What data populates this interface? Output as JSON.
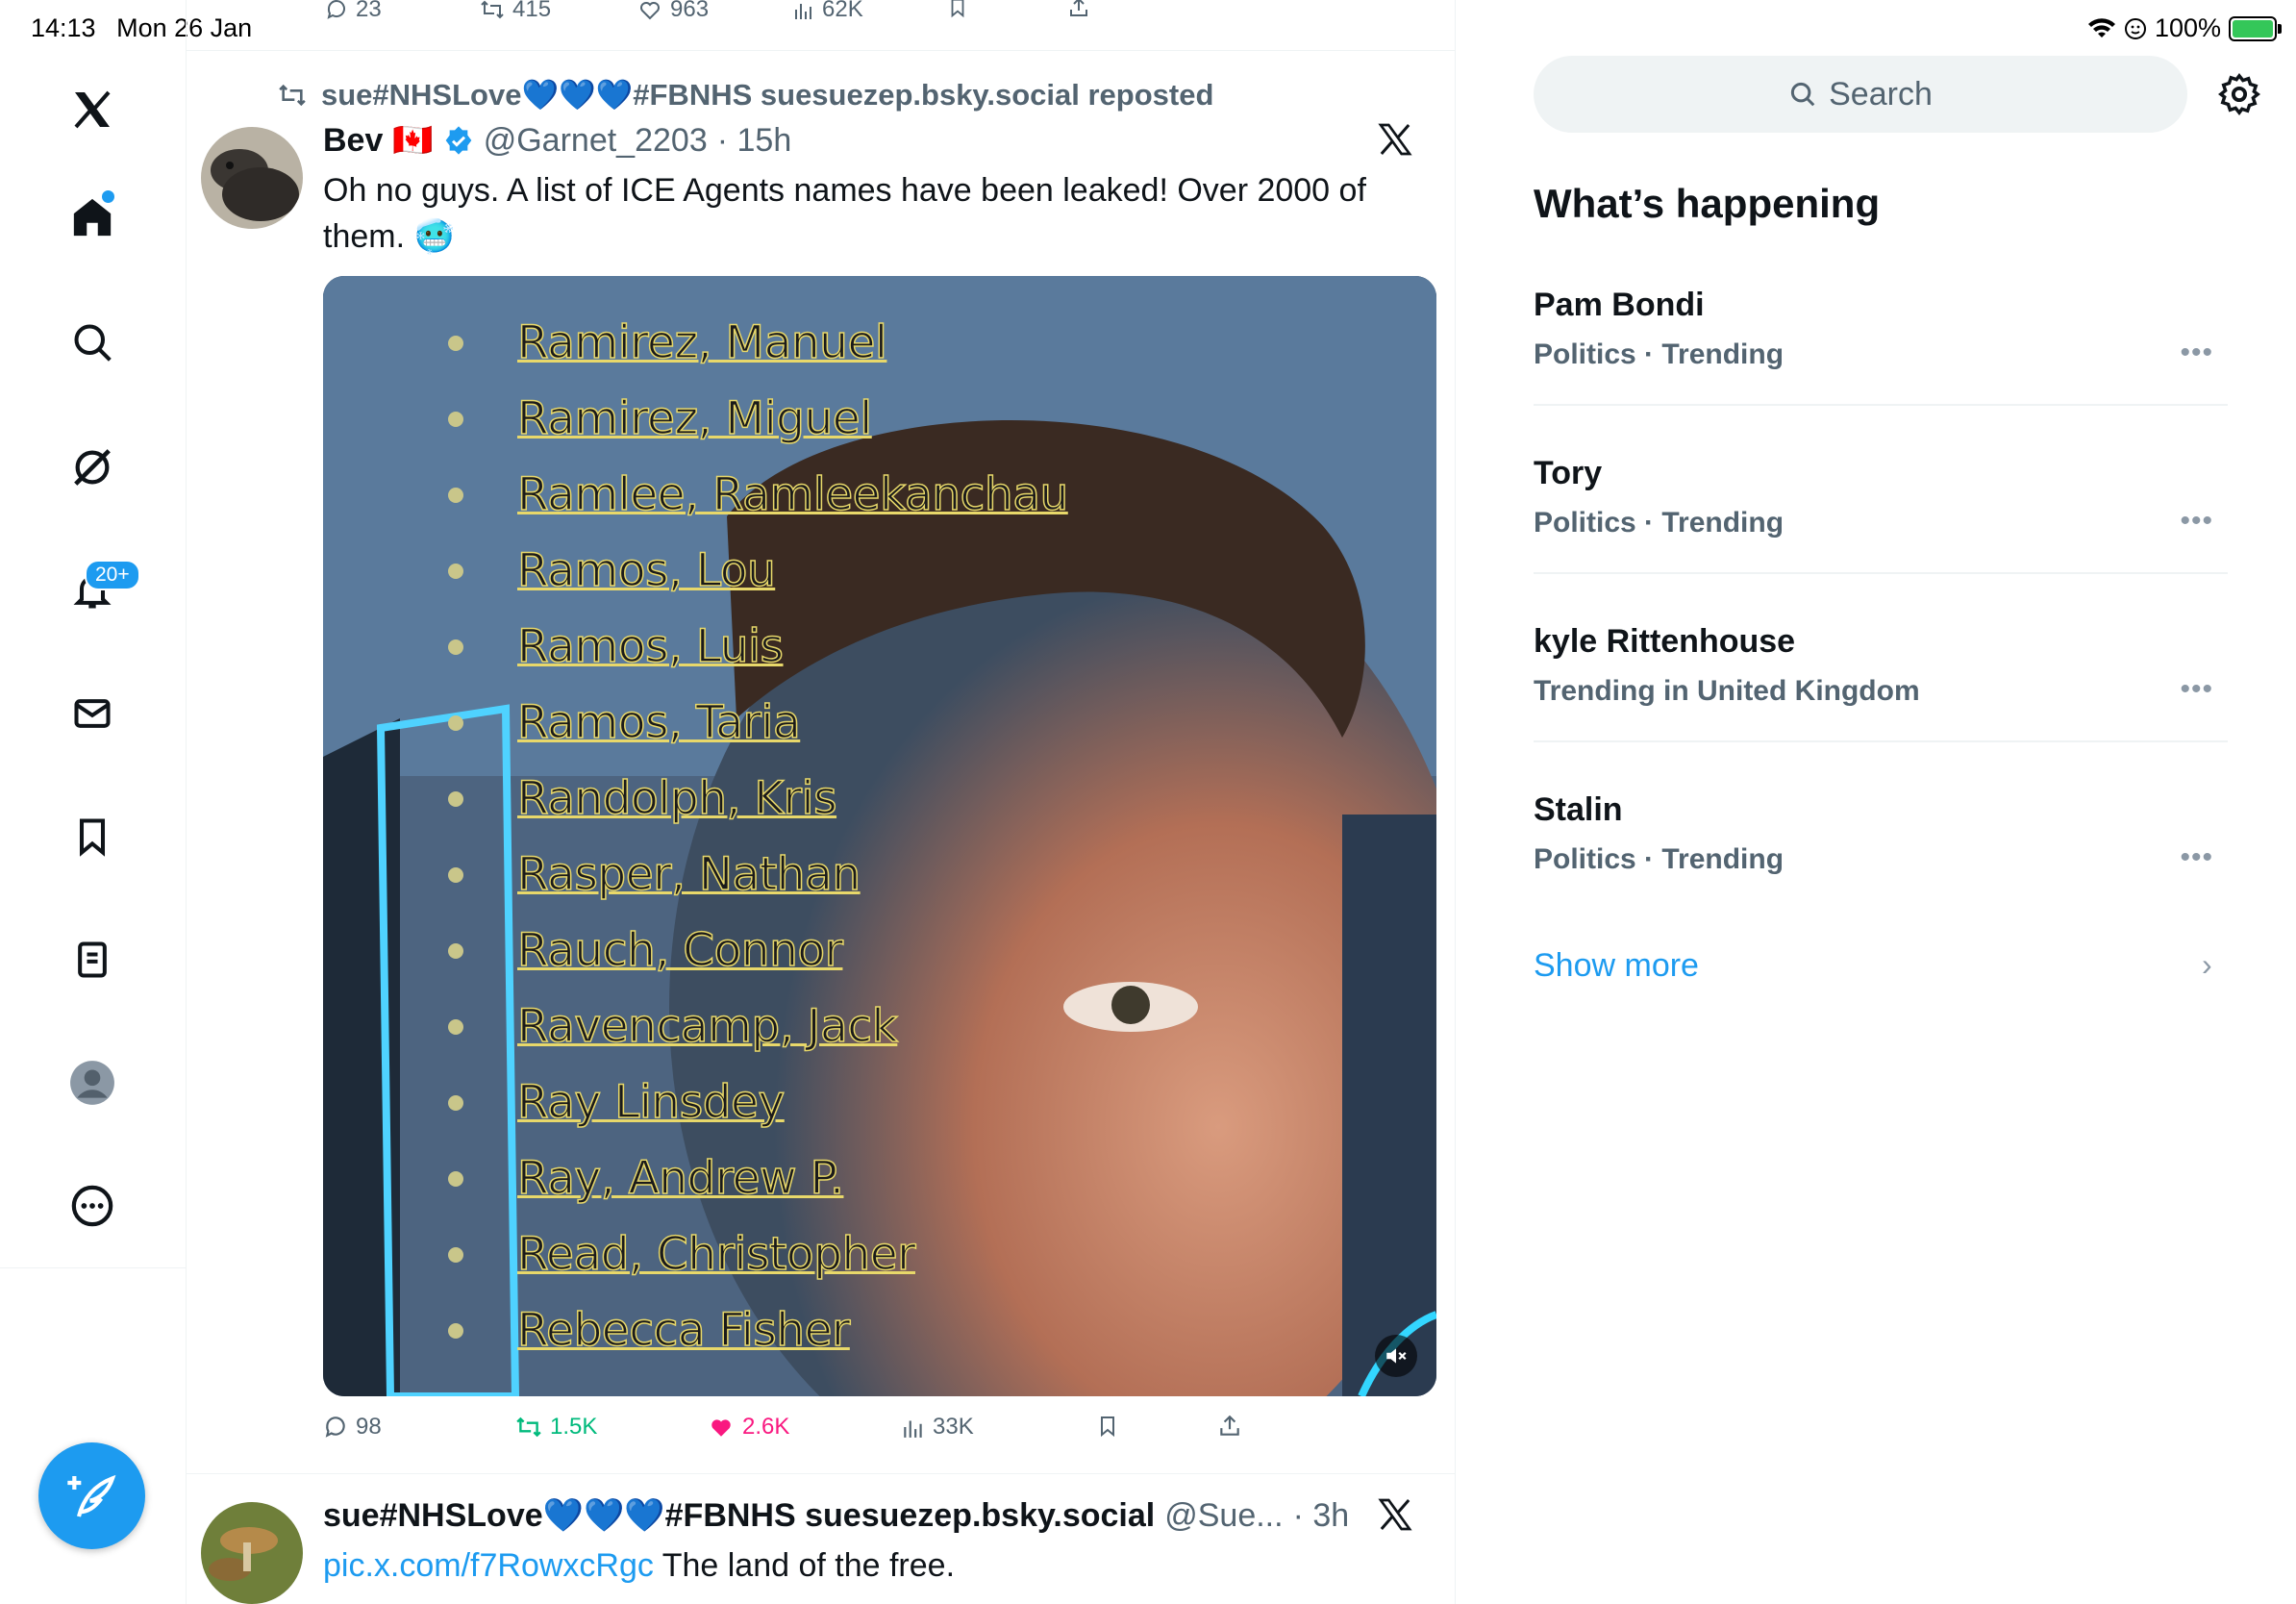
{
  "status_bar": {
    "time": "14:13",
    "date": "Mon 26 Jan",
    "battery": "100%"
  },
  "nav": {
    "items": [
      {
        "name": "x-logo-icon"
      },
      {
        "name": "home-icon"
      },
      {
        "name": "search-icon"
      },
      {
        "name": "grok-icon"
      },
      {
        "name": "notifications-icon"
      },
      {
        "name": "messages-icon"
      },
      {
        "name": "bookmarks-icon"
      },
      {
        "name": "lists-icon"
      },
      {
        "name": "profile-icon"
      },
      {
        "name": "more-icon"
      }
    ],
    "notifications_badge": "20+",
    "compose_icon": "compose-icon"
  },
  "previous_tweet_actions": {
    "replies": "23",
    "reposts": "415",
    "likes": "963",
    "views": "62K"
  },
  "tweet": {
    "repost_by": "sue#NHSLove💙💙💙#FBNHS suesuezep.bsky.social reposted",
    "author_name": "Bev",
    "author_flag": "🇨🇦",
    "handle": "@Garnet_2203",
    "time": "· 15h",
    "text": "Oh no guys.  A list of ICE Agents names have been leaked!  Over 2000 of them. 🥶",
    "media_names": [
      "Ramirez, Manuel",
      "Ramirez, Miguel",
      "Ramlee, Ramleekanchau",
      "Ramos, Lou",
      "Ramos, Luis",
      "Ramos, Taria",
      "Randolph, Kris",
      "Rasper, Nathan",
      "Rauch, Connor",
      "Ravencamp, Jack",
      "Ray Linsdey",
      "Ray, Andrew P.",
      "Read, Christopher",
      "Rebecca Fisher"
    ],
    "actions": {
      "replies": "98",
      "reposts": "1.5K",
      "likes": "2.6K",
      "views": "33K"
    }
  },
  "next_tweet": {
    "author_name": "sue#NHSLove💙💙💙#FBNHS suesuezep.bsky.social",
    "handle": "@Sue...",
    "time": "· 3h",
    "link": "pic.x.com/f7RowxcRgc",
    "text": " The land of the free."
  },
  "sidebar": {
    "search_placeholder": "Search",
    "title": "What’s happening",
    "trends": [
      {
        "name": "Pam Bondi",
        "meta": "Politics · Trending"
      },
      {
        "name": "Tory",
        "meta": "Politics · Trending"
      },
      {
        "name": "kyle Rittenhouse",
        "meta": "Trending in United Kingdom"
      },
      {
        "name": "Stalin",
        "meta": "Politics · Trending"
      }
    ],
    "show_more": "Show more"
  },
  "colors": {
    "accent": "#1d9bf0",
    "repost_green": "#00ba7c",
    "like_pink": "#f91880",
    "secondary_text": "#536471"
  }
}
